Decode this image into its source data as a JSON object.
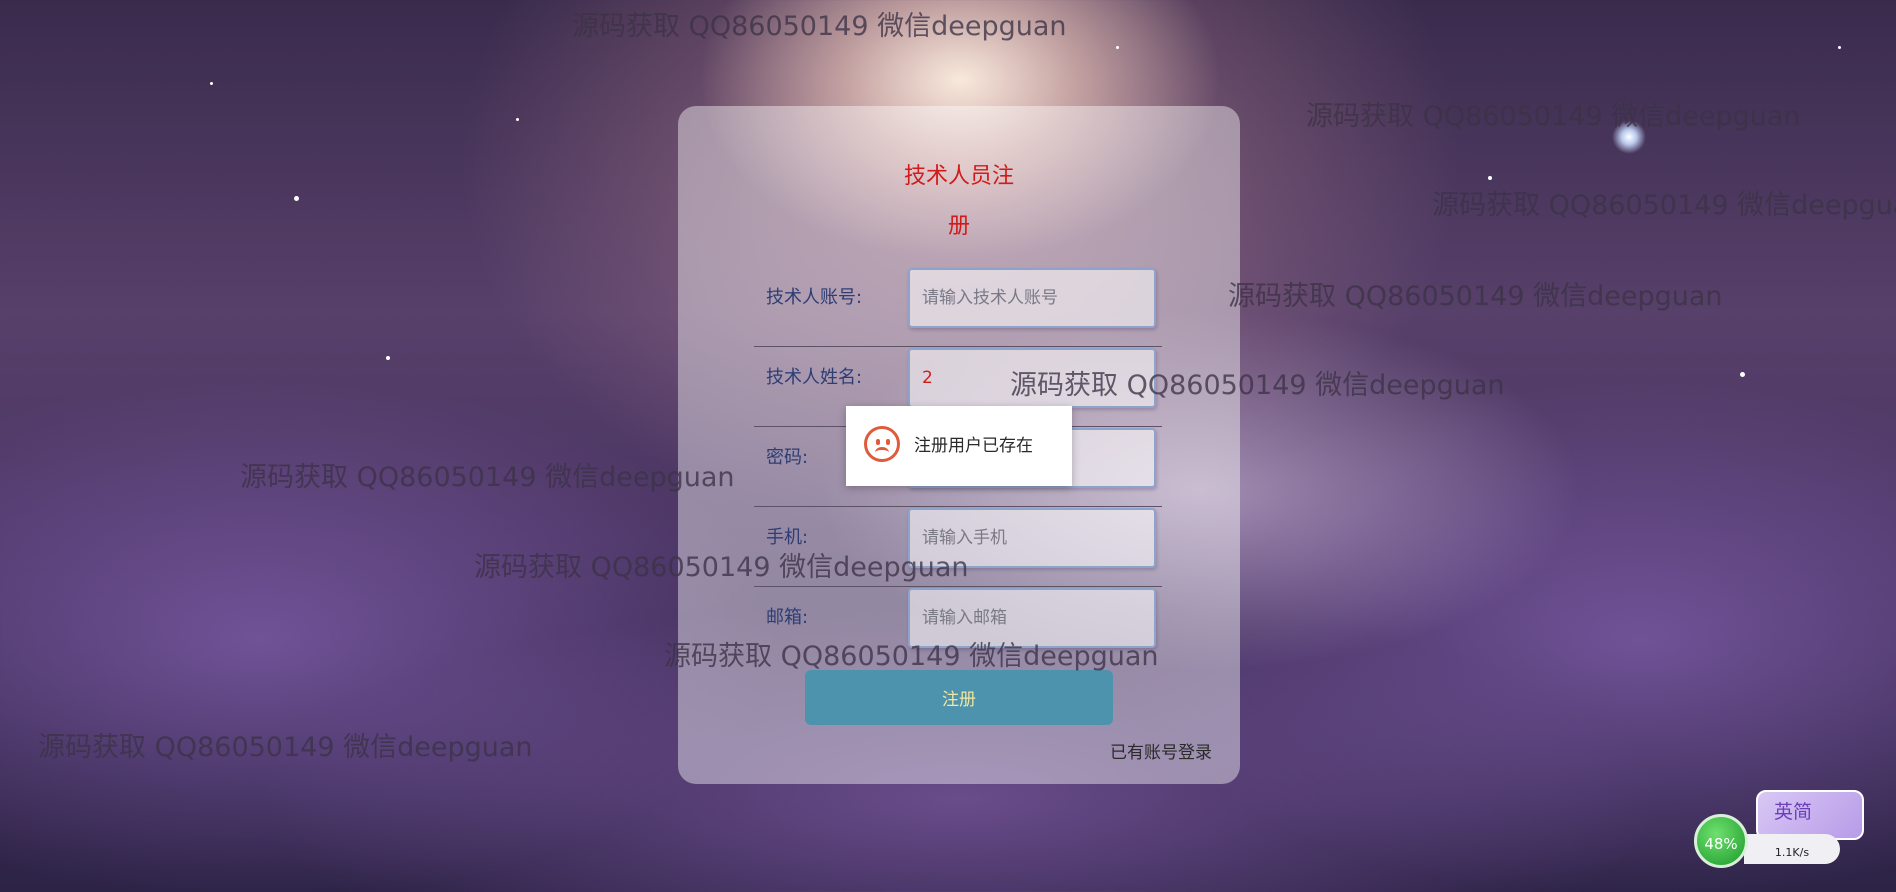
{
  "watermark_text": "源码获取 QQ86050149 微信deepguan",
  "form": {
    "title_line1": "技术人员注",
    "title_line2": "册",
    "fields": [
      {
        "label": "技术人账号:",
        "value": "",
        "placeholder": "请输入技术人账号"
      },
      {
        "label": "技术人姓名:",
        "value": "2",
        "placeholder": ""
      },
      {
        "label": "密码:",
        "value": "",
        "placeholder": ""
      },
      {
        "label": "手机:",
        "value": "",
        "placeholder": "请输入手机"
      },
      {
        "label": "邮箱:",
        "value": "",
        "placeholder": "请输入邮箱"
      }
    ],
    "register_label": "注册",
    "login_link": "已有账号登录"
  },
  "toast": {
    "icon": "sad-face-icon",
    "message": "注册用户已存在"
  },
  "ime": {
    "battery_percent": "48%",
    "speed": "1.1K/s",
    "mode": "英简"
  },
  "colors": {
    "title": "#d11b1b",
    "label": "#2e3d74",
    "button": "#4e93ad",
    "button_text": "#f2e6a0",
    "toast_icon": "#e05a3c"
  }
}
